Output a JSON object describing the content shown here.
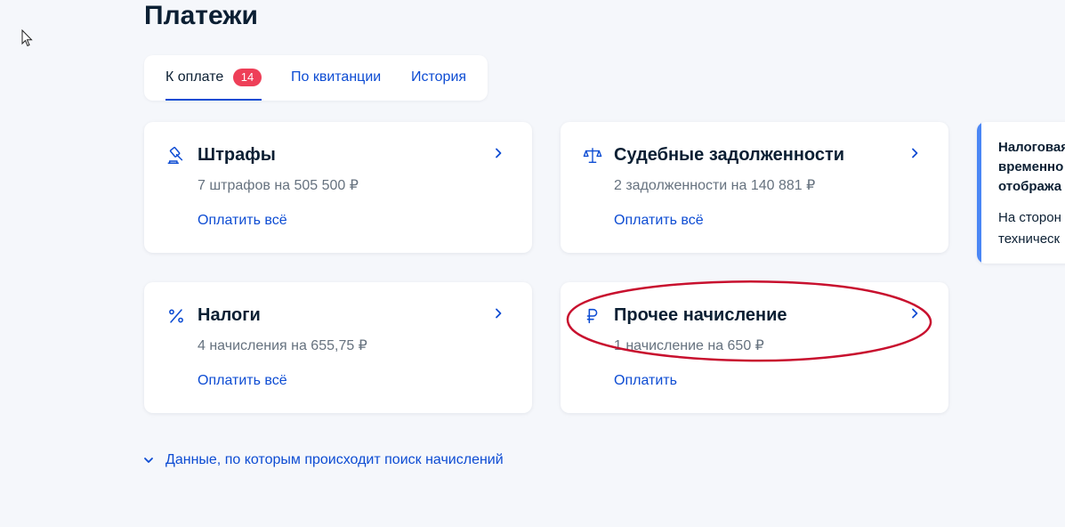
{
  "page_title": "Платежи",
  "tabs": [
    {
      "label": "К оплате",
      "badge": "14",
      "active": true
    },
    {
      "label": "По квитанции",
      "active": false
    },
    {
      "label": "История",
      "active": false
    }
  ],
  "cards": [
    {
      "icon": "gavel-icon",
      "title": "Штрафы",
      "subtitle": "7 штрафов на 505 500 ₽",
      "action": "Оплатить всё"
    },
    {
      "icon": "scales-icon",
      "title": "Судебные задолженности",
      "subtitle": "2 задолженности на 140 881 ₽",
      "action": "Оплатить всё"
    },
    {
      "icon": "percent-icon",
      "title": "Налоги",
      "subtitle": "4 начисления на 655,75 ₽",
      "action": "Оплатить всё"
    },
    {
      "icon": "ruble-icon",
      "title": "Прочее начисление",
      "subtitle": "1 начисление на 650 ₽",
      "action": "Оплатить"
    }
  ],
  "notice": {
    "title": "Налоговая\nвременно\nотобража",
    "text": "На сторон\nтехническ"
  },
  "expand_link": "Данные, по которым происходит поиск начислений",
  "colors": {
    "accent": "#0d4cd3",
    "badge": "#ee3f58",
    "annotation": "#c8102e",
    "notice_bar": "#4a86f5",
    "background": "#f5f7fb"
  }
}
